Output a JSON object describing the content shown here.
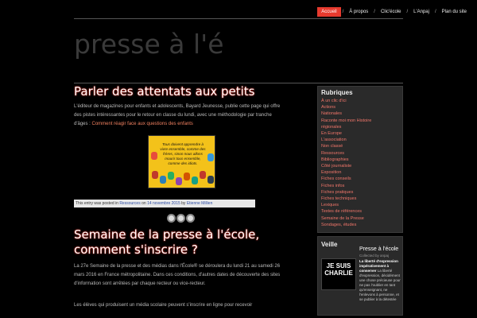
{
  "nav": {
    "items": [
      "Accueil",
      "À propos",
      "Clic'école",
      "L'Anpaj",
      "Plan du site"
    ]
  },
  "site": {
    "title": "presse à l'école"
  },
  "posts": [
    {
      "title": "Parler des attentats aux petits",
      "excerpt": "L'éditeur de magazines pour enfants et adolescents, Bayard Jeunesse, publie cette page qui offre des pistes intéressantes pour le retour en classe du lundi, avec une méthodologie par tranche d'âges :",
      "link": "Comment réagir face aux questions des enfants",
      "poster_caption": "Tous doivent apprendre à vivre ensemble, comme des frères, sinon nous allons mourir tous ensemble, comme des idiots.",
      "meta": {
        "prefix": "This entry was posted in",
        "category": "Ressources",
        "on": "on",
        "date": "14 novembre 2015",
        "by": "by",
        "author": "Etienne Millien"
      }
    },
    {
      "title_line1": "Semaine de la presse à l'école,",
      "title_line2": "comment s'inscrire ?",
      "excerpt": "La 27e Semaine de la presse et des médias dans l'École® se déroulera du lundi 21 au samedi 26 mars 2016 en France métropolitaine. Dans ces conditions, d'autres dates de découverte des sites d'information sont arrêtées par chaque recteur ou vice-recteur.",
      "excerpt2": "Les élèves qui produisent un média scolaire peuvent s'inscrire en ligne pour recevoir"
    }
  ],
  "sidebar": {
    "rubriques_title": "Rubriques",
    "rubriques": [
      "À un clic d'ici",
      "Actions",
      "Nationales",
      "Raconte moi mon Histoire",
      "régionales",
      "En Europe",
      "L'association",
      "Non classé",
      "Ressources",
      "Bibliographies",
      "Côté journaliste",
      "Exposition",
      "Fiches conseils",
      "Fiches infos",
      "Fiches pratiques",
      "Fiches techniques",
      "Lexiques",
      "Textes de références",
      "Semaine de la Presse",
      "Sondages, études"
    ],
    "veille": {
      "title": "Veille",
      "feed_title": "Presse à l'école",
      "feed_sub": "Collected by anpaj",
      "charlie_line1": "JE SUIS",
      "charlie_line2": "CHARLIE",
      "feed_bold": "La liberté d'expression impérativement à conserver",
      "feed_text": "La liberté d'expression, décidément une chose précieuse pour ne pas l'oublier en tant qu'enseignant, ne l'enlevons à personne, et se publier à la détestée"
    }
  },
  "colors": {
    "accent": "#e63a2e",
    "link": "#f0766a",
    "background": "#000000"
  }
}
